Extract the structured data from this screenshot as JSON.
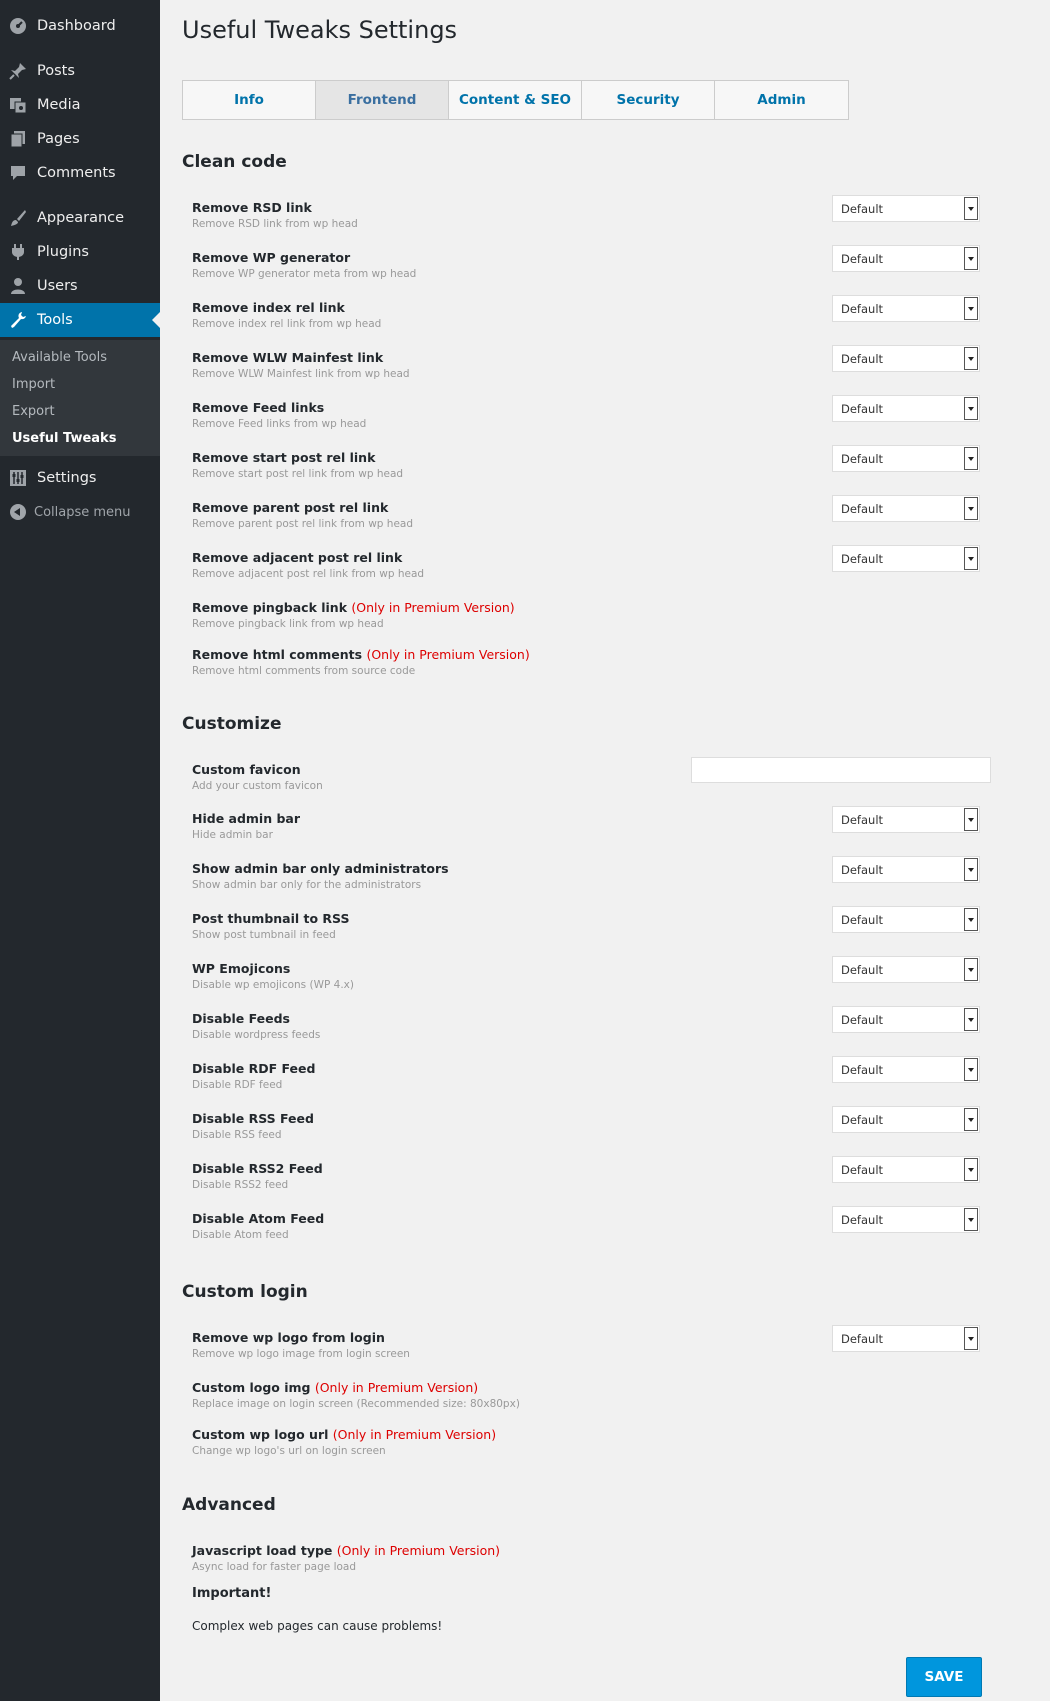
{
  "sidebar": {
    "items": [
      {
        "label": "Dashboard",
        "icon": "dashboard-icon"
      },
      {
        "label": "Posts",
        "icon": "pin-icon"
      },
      {
        "label": "Media",
        "icon": "media-icon"
      },
      {
        "label": "Pages",
        "icon": "pages-icon"
      },
      {
        "label": "Comments",
        "icon": "comments-icon"
      },
      {
        "label": "Appearance",
        "icon": "brush-icon"
      },
      {
        "label": "Plugins",
        "icon": "plugin-icon"
      },
      {
        "label": "Users",
        "icon": "users-icon"
      },
      {
        "label": "Tools",
        "icon": "wrench-icon"
      },
      {
        "label": "Settings",
        "icon": "settings-icon"
      }
    ],
    "submenu": [
      "Available Tools",
      "Import",
      "Export",
      "Useful Tweaks"
    ],
    "collapse": "Collapse menu"
  },
  "page_title": "Useful Tweaks Settings",
  "tabs": [
    "Info",
    "Frontend",
    "Content & SEO",
    "Security",
    "Admin"
  ],
  "active_tab": "Frontend",
  "premium_note": "(Only in Premium Version)",
  "select_default": "Default",
  "sections": {
    "clean_code": {
      "title": "Clean code",
      "rows": [
        {
          "label": "Remove RSD link",
          "desc": "Remove RSD link from wp head"
        },
        {
          "label": "Remove WP generator",
          "desc": "Remove WP generator meta from wp head"
        },
        {
          "label": "Remove index rel link",
          "desc": "Remove index rel link from wp head"
        },
        {
          "label": "Remove WLW Mainfest link",
          "desc": "Remove WLW Mainfest link from wp head"
        },
        {
          "label": "Remove Feed links",
          "desc": "Remove Feed links from wp head"
        },
        {
          "label": "Remove start post rel link",
          "desc": "Remove start post rel link from wp head"
        },
        {
          "label": "Remove parent post rel link",
          "desc": "Remove parent post rel link from wp head"
        },
        {
          "label": "Remove adjacent post rel link",
          "desc": "Remove adjacent post rel link from wp head"
        },
        {
          "label": "Remove pingback link",
          "desc": "Remove pingback link from wp head"
        },
        {
          "label": "Remove html comments",
          "desc": "Remove html comments from source code"
        }
      ]
    },
    "customize": {
      "title": "Customize",
      "rows": [
        {
          "label": "Custom favicon",
          "desc": "Add your custom favicon"
        },
        {
          "label": "Hide admin bar",
          "desc": "Hide admin bar"
        },
        {
          "label": "Show admin bar only administrators",
          "desc": "Show admin bar only for the administrators"
        },
        {
          "label": "Post thumbnail to RSS",
          "desc": "Show post tumbnail in feed"
        },
        {
          "label": "WP Emojicons",
          "desc": "Disable wp emojicons (WP 4.x)"
        },
        {
          "label": "Disable Feeds",
          "desc": "Disable wordpress feeds"
        },
        {
          "label": "Disable RDF Feed",
          "desc": "Disable RDF feed"
        },
        {
          "label": "Disable RSS Feed",
          "desc": "Disable RSS feed"
        },
        {
          "label": "Disable RSS2 Feed",
          "desc": "Disable RSS2 feed"
        },
        {
          "label": "Disable Atom Feed",
          "desc": "Disable Atom feed"
        }
      ]
    },
    "custom_login": {
      "title": "Custom login",
      "rows": [
        {
          "label": "Remove wp logo from login",
          "desc": "Remove wp logo image from login screen"
        },
        {
          "label": "Custom logo img",
          "desc": "Replace image on login screen (Recommended size: 80x80px)"
        },
        {
          "label": "Custom wp logo url",
          "desc": "Change wp logo's url on login screen"
        }
      ]
    },
    "advanced": {
      "title": "Advanced",
      "rows": [
        {
          "label": "Javascript load type",
          "desc": "Async load for faster page load"
        }
      ],
      "important": "Important!",
      "warning": "Complex web pages can cause problems!"
    }
  },
  "save_label": "SAVE",
  "colors": {
    "sidebar": "#23282d",
    "active": "#0073aa",
    "premium": "#dd0000",
    "save": "#0096dd"
  }
}
